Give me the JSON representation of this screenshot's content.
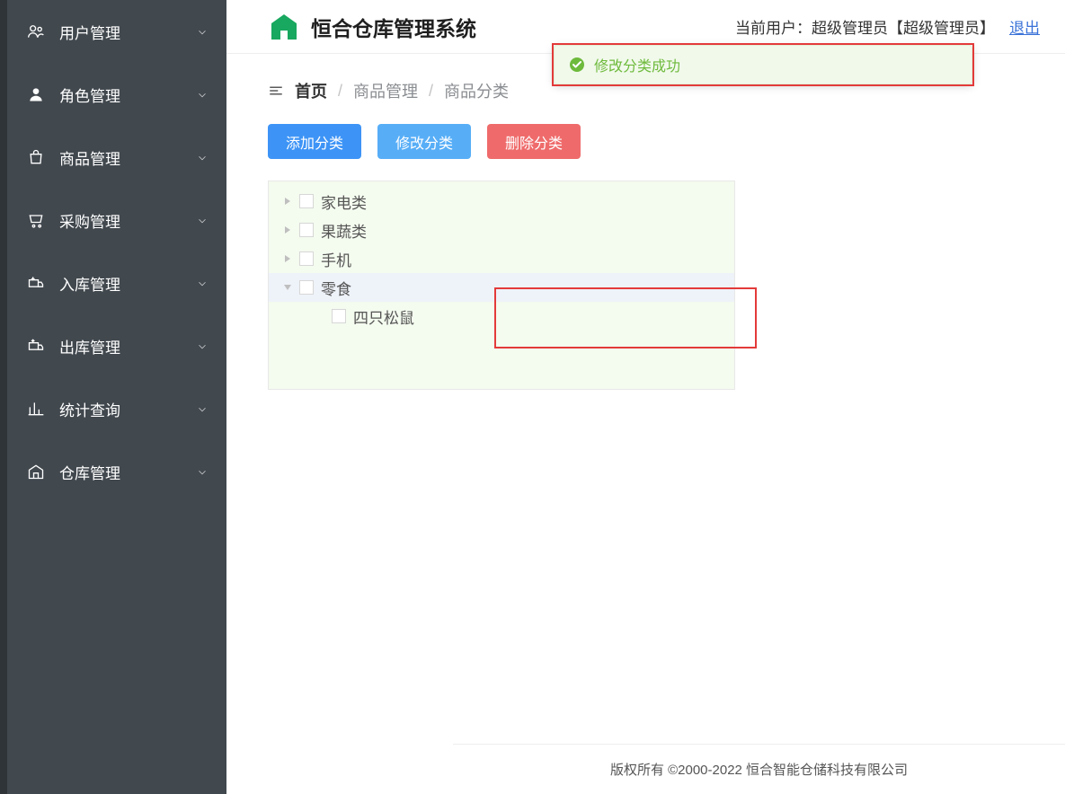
{
  "header": {
    "title": "恒合仓库管理系统",
    "current_user_prefix": "当前用户：",
    "current_user": "超级管理员【超级管理员】",
    "logout": "退出"
  },
  "sidebar": {
    "items": [
      {
        "label": "用户管理",
        "icon": "users"
      },
      {
        "label": "角色管理",
        "icon": "user"
      },
      {
        "label": "商品管理",
        "icon": "bag"
      },
      {
        "label": "采购管理",
        "icon": "cart"
      },
      {
        "label": "入库管理",
        "icon": "truck-in"
      },
      {
        "label": "出库管理",
        "icon": "truck-out"
      },
      {
        "label": "统计查询",
        "icon": "chart"
      },
      {
        "label": "仓库管理",
        "icon": "warehouse"
      }
    ]
  },
  "breadcrumb": {
    "home": "首页",
    "items": [
      "商品管理",
      "商品分类"
    ]
  },
  "actions": {
    "add": "添加分类",
    "edit": "修改分类",
    "delete": "删除分类"
  },
  "tree": {
    "nodes": [
      {
        "label": "家电类",
        "expanded": false,
        "selected": false,
        "hasChildren": true
      },
      {
        "label": "果蔬类",
        "expanded": false,
        "selected": false,
        "hasChildren": true
      },
      {
        "label": "手机",
        "expanded": false,
        "selected": false,
        "hasChildren": true
      },
      {
        "label": "零食",
        "expanded": true,
        "selected": true,
        "hasChildren": true,
        "children": [
          {
            "label": "四只松鼠"
          }
        ]
      }
    ]
  },
  "toast": {
    "message": "修改分类成功"
  },
  "footer": "版权所有 ©2000-2022  恒合智能仓储科技有限公司"
}
